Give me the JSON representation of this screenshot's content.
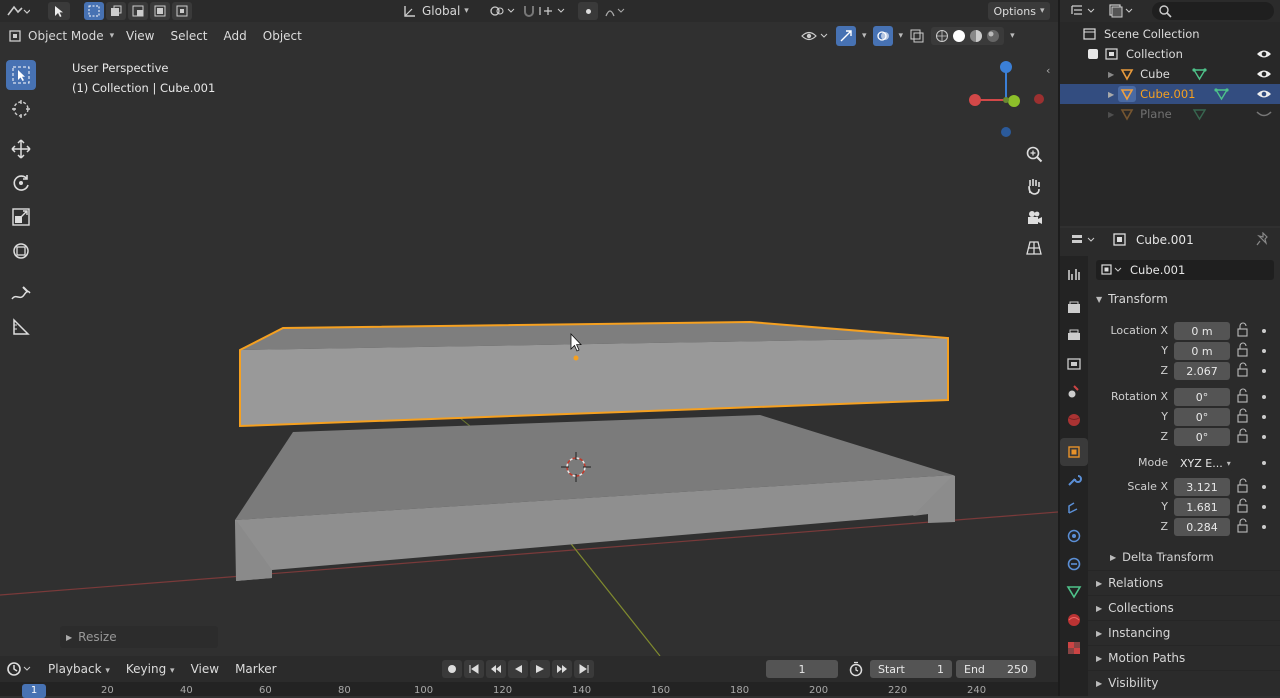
{
  "header": {
    "orientation": "Global",
    "options_label": "Options"
  },
  "view_header": {
    "mode": "Object Mode",
    "menus": [
      "View",
      "Select",
      "Add",
      "Object"
    ]
  },
  "viewport": {
    "perspective": "User Perspective",
    "collection_info": "(1) Collection | Cube.001",
    "last_operator": "Resize"
  },
  "outliner": {
    "scene_collection": "Scene Collection",
    "collection": "Collection",
    "objects": [
      "Cube",
      "Cube.001",
      "Plane"
    ]
  },
  "properties": {
    "object_name": "Cube.001",
    "datablock_name": "Cube.001",
    "section_transform": "Transform",
    "location_label": "Location X",
    "location": [
      "0 m",
      "0 m",
      "2.067"
    ],
    "rotation_label": "Rotation X",
    "rotation": [
      "0°",
      "0°",
      "0°"
    ],
    "mode_label": "Mode",
    "rotation_mode": "XYZ E...",
    "scale_label": "Scale X",
    "scale": [
      "3.121",
      "1.681",
      "0.284"
    ],
    "axis_y": "Y",
    "axis_z": "Z",
    "delta_transform": "Delta Transform",
    "panels": [
      "Relations",
      "Collections",
      "Instancing",
      "Motion Paths",
      "Visibility"
    ]
  },
  "timeline": {
    "menus": [
      "Playback",
      "Keying",
      "View",
      "Marker"
    ],
    "current_frame": "1",
    "start_label": "Start",
    "start": "1",
    "end_label": "End",
    "end": "250",
    "ruler_current": "1",
    "ruler_ticks": [
      "20",
      "40",
      "60",
      "80",
      "100",
      "120",
      "140",
      "160",
      "180",
      "200",
      "220",
      "240"
    ]
  },
  "colors": {
    "accent": "#4772b3",
    "selection_outline": "#f5a020",
    "background": "#303030"
  }
}
